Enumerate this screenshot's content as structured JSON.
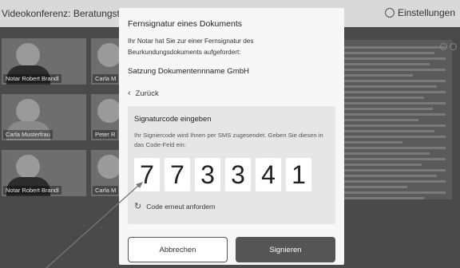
{
  "app": {
    "title": "Videokonferenz: Beratungstermin",
    "settings_label": "Einstellungen"
  },
  "participants": [
    {
      "name": "Notar Robert Brandl"
    },
    {
      "name": "Carla M"
    },
    {
      "name": "Carla Musterfrau"
    },
    {
      "name": "Peter R"
    },
    {
      "name": "Notar Robert Brandl"
    },
    {
      "name": "Carla M"
    }
  ],
  "modal": {
    "title": "Fernsignatur eines Dokuments",
    "intro": "Ihr Notar hat Sie zur einer Fernsignatur des Beurkundungsdokuments aufgefordert:",
    "document_name": "Satzung Dokumentennname GmbH",
    "back_label": "Zurück",
    "panel_title": "Signaturcode eingeben",
    "panel_text": "Ihr Signiercode wird Ihnen per SMS zugesendet. Geben Sie diesen in das Code-Feld ein:",
    "code_digits": [
      "7",
      "7",
      "3",
      "3",
      "4",
      "1"
    ],
    "resend_label": "Code erneut anfordern",
    "cancel_label": "Abbrechen",
    "sign_label": "Signieren"
  }
}
